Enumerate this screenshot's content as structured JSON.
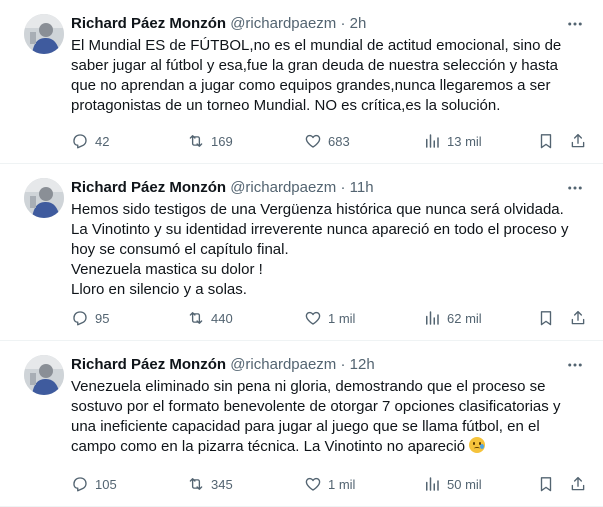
{
  "tweets": [
    {
      "name": "Richard Páez Monzón",
      "handle": "@richardpaezm",
      "separator": "·",
      "time": "2h",
      "lines": [
        "El Mundial ES de FÚTBOL,no es el mundial de actitud emocional, sino de",
        "saber jugar al fútbol y esa,fue la gran deuda de nuestra selección y hasta",
        "que no aprendan a jugar como equipos grandes,nunca llegaremos a ser",
        "protagonistas de un torneo Mundial. NO es crítica,es la solución."
      ],
      "replies": "42",
      "retweets": "169",
      "likes": "683",
      "views": "13 mil"
    },
    {
      "name": "Richard Páez Monzón",
      "handle": "@richardpaezm",
      "separator": "·",
      "time": "11h",
      "lines": [
        "Hemos sido testigos de una Vergüenza histórica que nunca será olvidada.",
        "La Vinotinto y su identidad irreverente nunca apareció en todo el proceso y",
        "hoy se consumó el capítulo final.",
        "Venezuela mastica su dolor !",
        "Lloro en silencio y a solas."
      ],
      "replies": "95",
      "retweets": "440",
      "likes": "1 mil",
      "views": "62 mil"
    },
    {
      "name": "Richard Páez Monzón",
      "handle": "@richardpaezm",
      "separator": "·",
      "time": "12h",
      "lines": [
        "Venezuela eliminado sin pena ni gloria, demostrando que el proceso se",
        "sostuvo por el formato benevolente de otorgar 7 opciones clasificatorias y",
        "una ineficiente capacidad para jugar al juego que se llama fútbol, en el",
        "campo como en la pizarra técnica. La Vinotinto no apareció"
      ],
      "replies": "105",
      "retweets": "345",
      "likes": "1 mil",
      "views": "50 mil"
    }
  ],
  "icons": {
    "more": "more-options-icon",
    "reply": "reply-icon",
    "retweet": "retweet-icon",
    "like": "heart-icon",
    "views": "views-chart-icon",
    "bookmark": "bookmark-icon",
    "share": "share-icon",
    "emoji": "crying-face-emoji"
  },
  "colors": {
    "text": "#0f1419",
    "muted": "#536471",
    "divider": "#eff3f4"
  }
}
